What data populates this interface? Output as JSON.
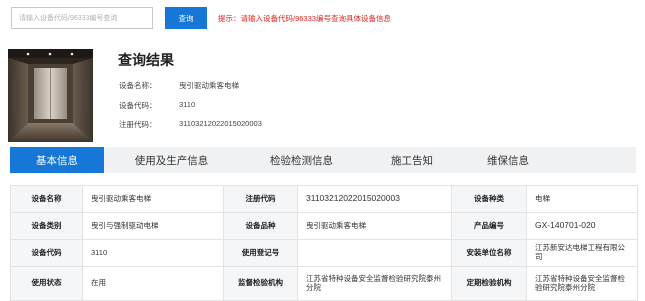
{
  "search": {
    "placeholder": "请输入设备代码/96333编号查询",
    "button_label": "查询",
    "hint": "提示：请输入设备代码/96333编号查询具体设备信息"
  },
  "result": {
    "title": "查询结果",
    "fields": [
      {
        "label": "设备名称：",
        "value": "曳引驱动乘客电梯"
      },
      {
        "label": "设备代码：",
        "value": "3110"
      },
      {
        "label": "注册代码：",
        "value": "31103212022015020003"
      }
    ]
  },
  "tabs": [
    {
      "label": "基本信息",
      "active": true
    },
    {
      "label": "使用及生产信息",
      "active": false
    },
    {
      "label": "检验检测信息",
      "active": false
    },
    {
      "label": "施工告知",
      "active": false
    },
    {
      "label": "维保信息",
      "active": false
    }
  ],
  "table": {
    "rows": [
      [
        {
          "label": "设备名称",
          "value": "曳引驱动乘客电梯"
        },
        {
          "label": "注册代码",
          "value": "31103212022015020003"
        },
        {
          "label": "设备种类",
          "value": "电梯"
        }
      ],
      [
        {
          "label": "设备类别",
          "value": "曳引与强制驱动电梯"
        },
        {
          "label": "设备品种",
          "value": "曳引驱动乘客电梯"
        },
        {
          "label": "产品编号",
          "value": "GX-140701-020"
        }
      ],
      [
        {
          "label": "设备代码",
          "value": "3110"
        },
        {
          "label": "使用登记号",
          "value": ""
        },
        {
          "label": "安装单位名称",
          "value": "江苏新安达电梯工程有限公司"
        }
      ],
      [
        {
          "label": "使用状态",
          "value": "在用"
        },
        {
          "label": "监督检验机构",
          "value": "江苏省特种设备安全监督检验研究院泰州分院"
        },
        {
          "label": "定期检验机构",
          "value": "江苏省特种设备安全监督检验研究院泰州分院"
        }
      ]
    ]
  },
  "colors": {
    "primary": "#1677d6",
    "hint": "#e2251f",
    "tab_bg": "#f0f1f3",
    "label_bg": "#f5f6f8"
  }
}
